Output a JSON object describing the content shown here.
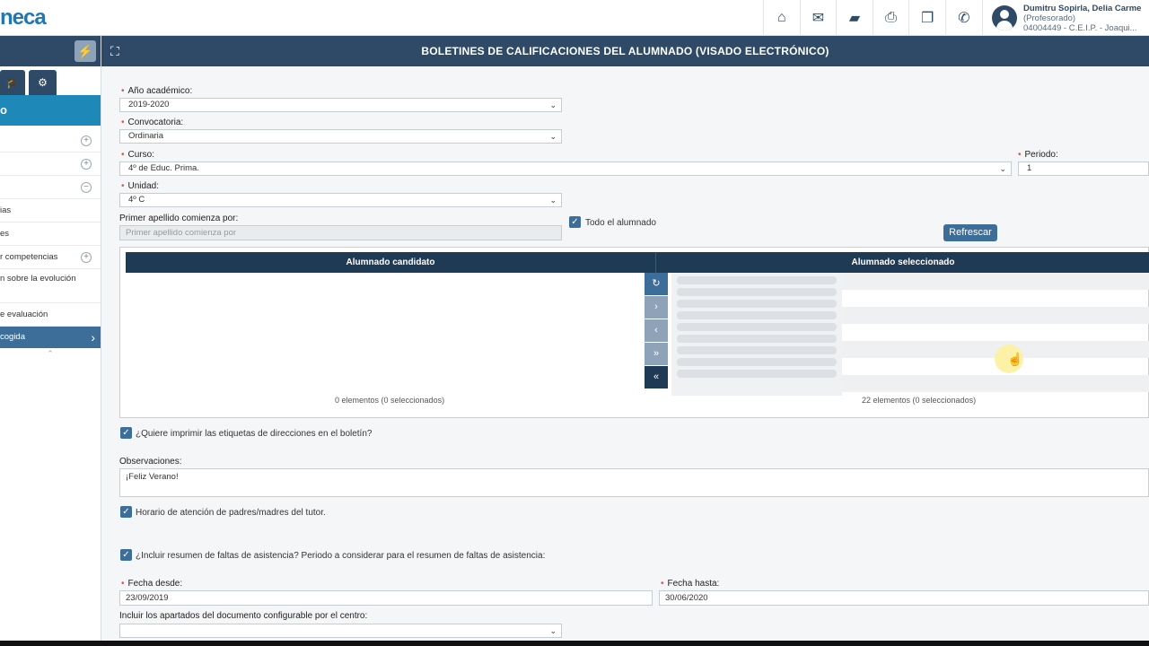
{
  "app": {
    "logo_text": "neca"
  },
  "topbar": {
    "icons": [
      "home-icon",
      "envelope-icon",
      "folder-icon",
      "print-icon",
      "copy-icon",
      "phone-icon"
    ],
    "user": {
      "name": "Dumitru Sopirla, Delia Carme",
      "role": "(Profesorado)",
      "center": "04004449 - C.E.I.P. - Joaqui..."
    }
  },
  "sidebar": {
    "title": "o",
    "items": [
      {
        "label": ""
      },
      {
        "label": ""
      },
      {
        "label": ""
      },
      {
        "label": "ias"
      },
      {
        "label": "es"
      },
      {
        "label": "r competencias"
      },
      {
        "label": "n sobre la evolución"
      },
      {
        "label": "e evaluación"
      },
      {
        "label": "cogida"
      }
    ]
  },
  "page": {
    "title": "BOLETINES DE CALIFICACIONES DEL ALUMNADO (VISADO ELECTRÓNICO)"
  },
  "form": {
    "anio": {
      "label": "Año académico:",
      "value": "2019-2020"
    },
    "convocatoria": {
      "label": "Convocatoria:",
      "value": "Ordinaria"
    },
    "curso": {
      "label": "Curso:",
      "value": "4º de Educ. Prima."
    },
    "periodo": {
      "label": "Periodo:",
      "value": "1"
    },
    "unidad": {
      "label": "Unidad:",
      "value": "4º C"
    },
    "apellido": {
      "label": "Primer apellido comienza por:",
      "placeholder": "Primer apellido comienza por"
    },
    "todo_alumnado": {
      "label": "Todo el alumnado",
      "checked": true
    },
    "refrescar": "Refrescar"
  },
  "lists": {
    "candidato": {
      "header": "Alumnado candidato",
      "count": "0 elementos (0 seleccionados)"
    },
    "seleccionado": {
      "header": "Alumnado seleccionado",
      "count": "22 elementos (0 seleccionados)"
    }
  },
  "options": {
    "etiquetas": {
      "label": "¿Quiere imprimir las etiquetas de direcciones en el boletín?",
      "checked": true
    },
    "observaciones": {
      "label": "Observaciones:",
      "value": "¡Feliz Verano!"
    },
    "horario": {
      "label": "Horario de atención de padres/madres del tutor.",
      "checked": true
    },
    "faltas": {
      "label": "¿Incluir resumen de faltas de asistencia? Periodo a considerar para el resumen de faltas de asistencia:",
      "checked": true
    },
    "fecha_desde": {
      "label": "Fecha desde:",
      "value": "23/09/2019"
    },
    "fecha_hasta": {
      "label": "Fecha hasta:",
      "value": "30/06/2020"
    },
    "apartados": {
      "label": "Incluir los apartados del documento configurable por el centro:",
      "value": ""
    }
  }
}
